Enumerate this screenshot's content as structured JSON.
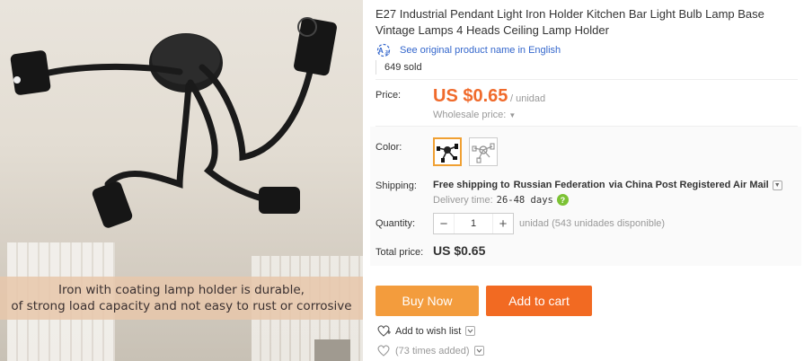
{
  "gallery": {
    "caption_line1": "Iron with coating lamp holder is durable,",
    "caption_line2": "of strong load capacity and not easy to rust or corrosive"
  },
  "product": {
    "title": "E27 Industrial Pendant Light Iron Holder Kitchen Bar Light Bulb Lamp Base Vintage Lamps 4 Heads Ceiling Lamp Holder",
    "see_original": "See original product name in English",
    "sold": "649 sold"
  },
  "price": {
    "label": "Price:",
    "value": "US $0.65",
    "unit": "/ unidad",
    "wholesale": "Wholesale price:"
  },
  "color": {
    "label": "Color:",
    "options": [
      "black-lamp-holder",
      "white-lamp-holder"
    ],
    "selected_index": 0
  },
  "shipping": {
    "label": "Shipping:",
    "free": "Free shipping to",
    "country": "Russian Federation",
    "via": "via China Post Registered Air Mail",
    "delivery_label": "Delivery time:",
    "delivery_days": "26-48 days"
  },
  "quantity": {
    "label": "Quantity:",
    "value": "1",
    "availability": "unidad (543 unidades disponible)"
  },
  "total": {
    "label": "Total price:",
    "value": "US $0.65"
  },
  "actions": {
    "buy_now": "Buy Now",
    "add_to_cart": "Add to cart",
    "wish_list": "Add to wish list",
    "times_added": "(73 times added)"
  },
  "colors": {
    "price_orange": "#f06a2b",
    "buy_now_bg": "#f39c3d",
    "add_to_cart_bg": "#f26a22",
    "link_blue": "#3366cc",
    "delivery_ok_green": "#7cc234"
  }
}
